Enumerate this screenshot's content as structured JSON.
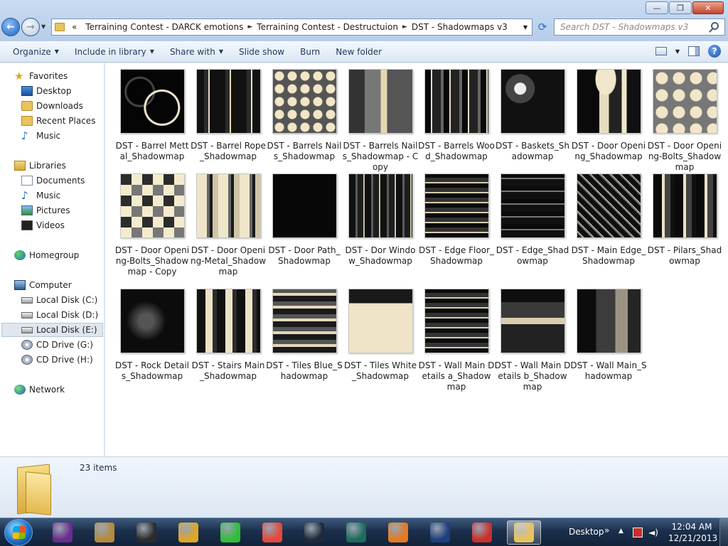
{
  "window": {
    "controls": {
      "minimize": "—",
      "maximize": "❐",
      "close": "✕"
    }
  },
  "address": {
    "prefix": "«",
    "crumbs": [
      "Terraining Contest - DARCK emotions",
      "Terraining Contest - Destructuion",
      "DST - Shadowmaps v3"
    ],
    "separator": "►"
  },
  "search": {
    "placeholder": "Search DST - Shadowmaps v3"
  },
  "toolbar": {
    "organize": "Organize",
    "include_in_library": "Include in library",
    "share_with": "Share with",
    "slide_show": "Slide show",
    "burn": "Burn",
    "new_folder": "New folder",
    "help": "?"
  },
  "nav": {
    "favorites": "Favorites",
    "desktop": "Desktop",
    "downloads": "Downloads",
    "recent_places": "Recent Places",
    "music_fav": "Music",
    "libraries": "Libraries",
    "documents": "Documents",
    "music": "Music",
    "pictures": "Pictures",
    "videos": "Videos",
    "homegroup": "Homegroup",
    "computer": "Computer",
    "disk_c": "Local Disk (C:)",
    "disk_d": "Local Disk (D:)",
    "disk_e": "Local Disk (E:)",
    "cd_g": "CD Drive (G:)",
    "cd_h": "CD Drive (H:)",
    "network": "Network"
  },
  "files": [
    {
      "label": "DST - Barrel Mettal_Shadowmap",
      "style": "circles-dark"
    },
    {
      "label": "DST - Barrel Rope_Shadowmap",
      "style": "stripes-dark"
    },
    {
      "label": "DST - Barrels Nails_Shadowmap",
      "style": "dots-grey"
    },
    {
      "label": "DST - Barrels Nails_Shadowmap - Copy",
      "style": "blocks-grey"
    },
    {
      "label": "DST - Barrels Wood_Shadowmap",
      "style": "vert-mixed"
    },
    {
      "label": "DST - Baskets_Shadowmap",
      "style": "hex-grey"
    },
    {
      "label": "DST - Door Opening_Shadowmap",
      "style": "arch-dark"
    },
    {
      "label": "DST - Door Opening-Bolts_Shadowmap",
      "style": "dots-cream"
    },
    {
      "label": "DST - Door Opening-Bolts_Shadowmap - Copy",
      "style": "checker-cream"
    },
    {
      "label": "DST - Door Opening-Metal_Shadowmap",
      "style": "bars-cream"
    },
    {
      "label": "DST - Door Path_Shadowmap",
      "style": "black"
    },
    {
      "label": "DST - Dor Window_Shadowmap",
      "style": "vert-dark"
    },
    {
      "label": "DST - Edge Floor_Shadowmap",
      "style": "grid-mixed"
    },
    {
      "label": "DST - Edge_Shadowmap",
      "style": "grid-dark"
    },
    {
      "label": "DST - Main Edge_Shadowmap",
      "style": "noise-dark"
    },
    {
      "label": "DST - Pilars_Shadowmap",
      "style": "vert-mixed2"
    },
    {
      "label": "DST - Rock Details_Shadowmap",
      "style": "rock-dark"
    },
    {
      "label": "DST - Stairs Main_Shadowmap",
      "style": "stairs"
    },
    {
      "label": "DST - Tiles Blue_Shadowmap",
      "style": "tiles"
    },
    {
      "label": "DST - Tiles White_Shadowmap",
      "style": "tiles-white"
    },
    {
      "label": "DST - Wall Main Details a_Shadowmap",
      "style": "grid-mixed"
    },
    {
      "label": "DST - Wall Main Details b_Shadowmap",
      "style": "wall-b"
    },
    {
      "label": "DST - Wall Main_Shadowmap",
      "style": "wall-main"
    }
  ],
  "details": {
    "count": "23 items"
  },
  "taskbar": {
    "desktop_label": "Desktop",
    "show_toolbar": "»",
    "time": "12:04 AM",
    "date": "12/21/2013",
    "apps": [
      {
        "name": "vlc-like-purple",
        "color": "#6a2c8e"
      },
      {
        "name": "quill-app",
        "color": "#b48a3c"
      },
      {
        "name": "chip-app",
        "color": "#2b2b2b"
      },
      {
        "name": "eye-app",
        "color": "#e1a528"
      },
      {
        "name": "green-app",
        "color": "#2fbf3a"
      },
      {
        "name": "chrome",
        "color": "#e5483b"
      },
      {
        "name": "fan-app",
        "color": "#1e2a3a"
      },
      {
        "name": "steam-like",
        "color": "#1e6b5c"
      },
      {
        "name": "firefox",
        "color": "#e57a1f"
      },
      {
        "name": "photoshop",
        "color": "#1d3f7c"
      },
      {
        "name": "camera-app",
        "color": "#c9302c"
      },
      {
        "name": "explorer",
        "color": "#e8c45c"
      }
    ]
  }
}
